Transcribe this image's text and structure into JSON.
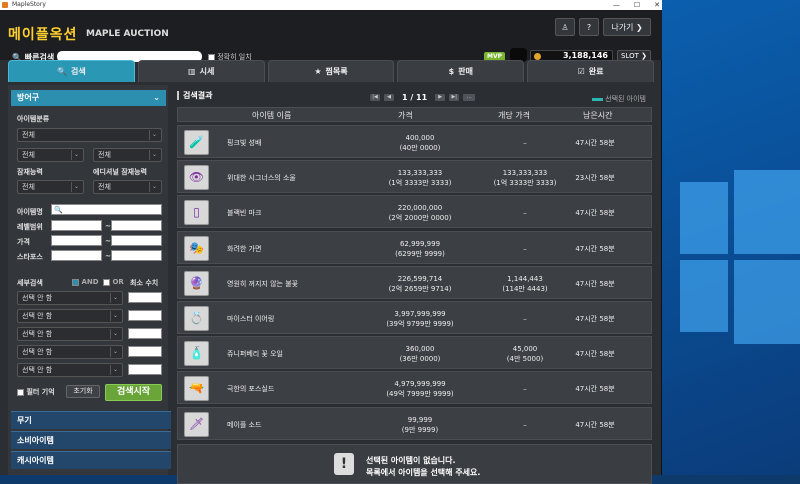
{
  "window": {
    "title": "MapleStory",
    "controls": [
      "—",
      "☐",
      "✕"
    ]
  },
  "header": {
    "logo_kr": "메이플옥션",
    "logo_en": "MAPLE AUCTION",
    "exit_label": "나가기 ❯",
    "search_label": "빠른검색",
    "exact_match": "정확히 일치",
    "mvp": "MVP",
    "meso": "3,188,146",
    "slot": "SLOT ❯"
  },
  "tabs": [
    {
      "label": "검색",
      "icon": "🔍"
    },
    {
      "label": "시세",
      "icon": "▥"
    },
    {
      "label": "찜목록",
      "icon": "★"
    },
    {
      "label": "판매",
      "icon": "$"
    },
    {
      "label": "완료",
      "icon": "☑"
    }
  ],
  "filters": {
    "category_head": "방어구",
    "item_class_label": "아이템분류",
    "all": "전체",
    "potential_label": "잠재능력",
    "add_potential_label": "에디셔널 잠재능력",
    "item_name_label": "아이템명",
    "level_label": "레벨범위",
    "price_label": "가격",
    "starforce_label": "스타포스",
    "tilde": "~",
    "detail_label": "세부검색",
    "and": "AND",
    "or": "OR",
    "min_label": "최소 수치",
    "option_placeholder": "선택 안 함",
    "remember_label": "필터 기억",
    "reset_label": "초기화",
    "search_btn": "검색시작"
  },
  "categories": [
    "무기",
    "소비아이템",
    "캐시아이템"
  ],
  "results": {
    "title": "검색결과",
    "page": "1 / 11",
    "legend": "선택된 아이템",
    "columns": {
      "name": "아이템 이름",
      "price": "가격",
      "unit": "개당 가격",
      "time": "남은시간"
    },
    "rows": [
      {
        "icon": "🧪",
        "name": "핑크빛 성배",
        "price": "400,000",
        "price_sub": "(40만 0000)",
        "unit": "–",
        "unit_sub": "",
        "time": "47시간 58분"
      },
      {
        "icon": "👁",
        "name": "위대한 시그너스의 소울",
        "price": "133,333,333",
        "price_sub": "(1억 3333만 3333)",
        "unit": "133,333,333",
        "unit_sub": "(1억 3333만 3333)",
        "time": "23시간 58분"
      },
      {
        "icon": "▯",
        "name": "블랙빈 마크",
        "price": "220,000,000",
        "price_sub": "(2억 2000만 0000)",
        "unit": "–",
        "unit_sub": "",
        "time": "47시간 58분"
      },
      {
        "icon": "🎭",
        "name": "화려한 가면",
        "price": "62,999,999",
        "price_sub": "(6299만 9999)",
        "unit": "–",
        "unit_sub": "",
        "time": "47시간 58분"
      },
      {
        "icon": "🔮",
        "name": "영원히 꺼지지 않는 불꽃",
        "price": "226,599,714",
        "price_sub": "(2억 2659만 9714)",
        "unit": "1,144,443",
        "unit_sub": "(114만 4443)",
        "time": "47시간 58분"
      },
      {
        "icon": "💍",
        "name": "마이스터 이어링",
        "price": "3,997,999,999",
        "price_sub": "(39억 9799만 9999)",
        "unit": "–",
        "unit_sub": "",
        "time": "47시간 58분"
      },
      {
        "icon": "🧴",
        "name": "쥬니퍼베리 꽃 오일",
        "price": "360,000",
        "price_sub": "(36만 0000)",
        "unit": "45,000",
        "unit_sub": "(4만 5000)",
        "time": "47시간 58분"
      },
      {
        "icon": "🔫",
        "name": "극한의 포스실드",
        "price": "4,979,999,999",
        "price_sub": "(49억 7999만 9999)",
        "unit": "–",
        "unit_sub": "",
        "time": "47시간 58분"
      },
      {
        "icon": "🗡",
        "name": "메이플 소드",
        "price": "99,999",
        "price_sub": "(9만 9999)",
        "unit": "–",
        "unit_sub": "",
        "time": "47시간 58분"
      }
    ],
    "empty_msg1": "선택된 아이템이 없습니다.",
    "empty_msg2": "목록에서 아이템을 선택해 주세요."
  }
}
